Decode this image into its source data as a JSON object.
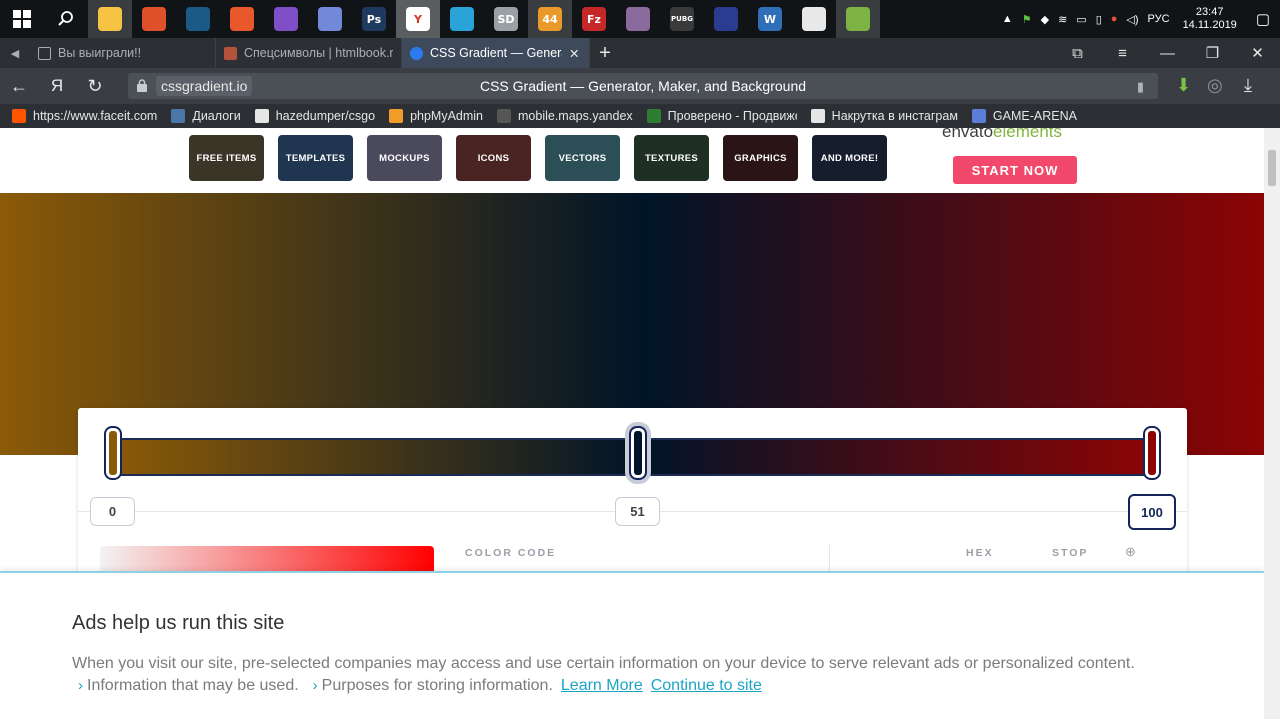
{
  "taskbar": {
    "apps": [
      {
        "icon": "windows-start-icon",
        "color": "#ffffff"
      },
      {
        "icon": "search-icon",
        "color": "#ffffff"
      },
      {
        "icon": "file-explorer-icon",
        "color": "#f6c343"
      },
      {
        "icon": "shield-app-icon",
        "color": "#e0502a"
      },
      {
        "icon": "steam-icon",
        "color": "#1b5a86"
      },
      {
        "icon": "arrow-app-icon",
        "color": "#e8582a"
      },
      {
        "icon": "visual-studio-icon",
        "color": "#7f4fc8"
      },
      {
        "icon": "discord-icon",
        "color": "#7289da"
      },
      {
        "icon": "photoshop-icon",
        "color": "#1f3a5f",
        "label": "Ps"
      },
      {
        "icon": "yandex-browser-icon",
        "color": "#ffffff",
        "label": "Y"
      },
      {
        "icon": "telegram-style-icon",
        "color": "#2aa3d8"
      },
      {
        "icon": "gear-app-icon",
        "color": "#9aa0a6",
        "label": "SD"
      },
      {
        "icon": "telegram-icon",
        "color": "#e99a2b",
        "label": "44"
      },
      {
        "icon": "filezilla-icon",
        "color": "#c62828",
        "label": "Fz"
      },
      {
        "icon": "archive-icon",
        "color": "#8b6b9e"
      },
      {
        "icon": "pubg-icon",
        "color": "#3a3a3a",
        "label": "PUBG"
      },
      {
        "icon": "app-disc-icon",
        "color": "#2b3b8f"
      },
      {
        "icon": "w-app-icon",
        "color": "#2f6fb8",
        "label": "W"
      },
      {
        "icon": "cs-icon",
        "color": "#e8e8e8"
      },
      {
        "icon": "notepad-icon",
        "color": "#7cb342"
      }
    ],
    "tray": {
      "language": "РУС",
      "time": "23:47",
      "date": "14.11.2019"
    }
  },
  "tabs": [
    {
      "label": "Вы выиграли!!",
      "favicon": "#aaaaaa",
      "icon": "document-icon"
    },
    {
      "label": "Спецсимволы | htmlbook.ru",
      "favicon": "#b5523b",
      "icon": "htmlbook-icon"
    },
    {
      "label": "CSS Gradient — Generator",
      "favicon": "#2d7bf0",
      "icon": "cssgradient-icon",
      "active": true
    }
  ],
  "addressbar": {
    "domain": "cssgradient.io",
    "title": "CSS Gradient — Generator, Maker, and Background",
    "yandex_glyph": "Я"
  },
  "bookmarks": [
    {
      "label": "https://www.faceit.com",
      "color": "#ff5500"
    },
    {
      "label": "Диалоги",
      "color": "#4a76a8"
    },
    {
      "label": "hazedumper/csgo",
      "color": "#e6e6e6"
    },
    {
      "label": "phpMyAdmin",
      "color": "#f29d2a"
    },
    {
      "label": "mobile.maps.yandex",
      "color": "#555555"
    },
    {
      "label": "Проверено - Продвижение",
      "color": "#2e7d32"
    },
    {
      "label": "Накрутка в инстаграм",
      "color": "#e6e6e6"
    },
    {
      "label": "GAME-ARENA",
      "color": "#5b7fd6"
    }
  ],
  "ad_banner": {
    "tiles": [
      {
        "label": "FREE ITEMS",
        "color": "#3a3526"
      },
      {
        "label": "TEMPLATES",
        "color": "#1f3550"
      },
      {
        "label": "MOCKUPS",
        "color": "#4b4a5c"
      },
      {
        "label": "ICONS",
        "color": "#4a2323"
      },
      {
        "label": "VECTORS",
        "color": "#2b4e57"
      },
      {
        "label": "TEXTURES",
        "color": "#1f2f23"
      },
      {
        "label": "GRAPHICS",
        "color": "#2a1416"
      },
      {
        "label": "AND MORE!",
        "color": "#161e2e"
      }
    ],
    "brand_a": "envato",
    "brand_b": "elements",
    "cta": "START NOW"
  },
  "gradient": {
    "colors": [
      "#8b5a07",
      "#001428",
      "#8c0404"
    ],
    "stops": [
      "0",
      "51",
      "100"
    ],
    "selected_stop": "100"
  },
  "editor": {
    "color_code_label": "COLOR CODE",
    "hex_label": "HEX",
    "stop_label": "STOP"
  },
  "consent": {
    "title": "Ads help us run this site",
    "body": "When you visit our site, pre-selected companies may access and use certain information on your device to serve relevant ads or personalized content.",
    "info_used": "Information that may be used.",
    "purposes": "Purposes for storing information.",
    "learn_more": "Learn More",
    "continue": "Continue to site"
  }
}
